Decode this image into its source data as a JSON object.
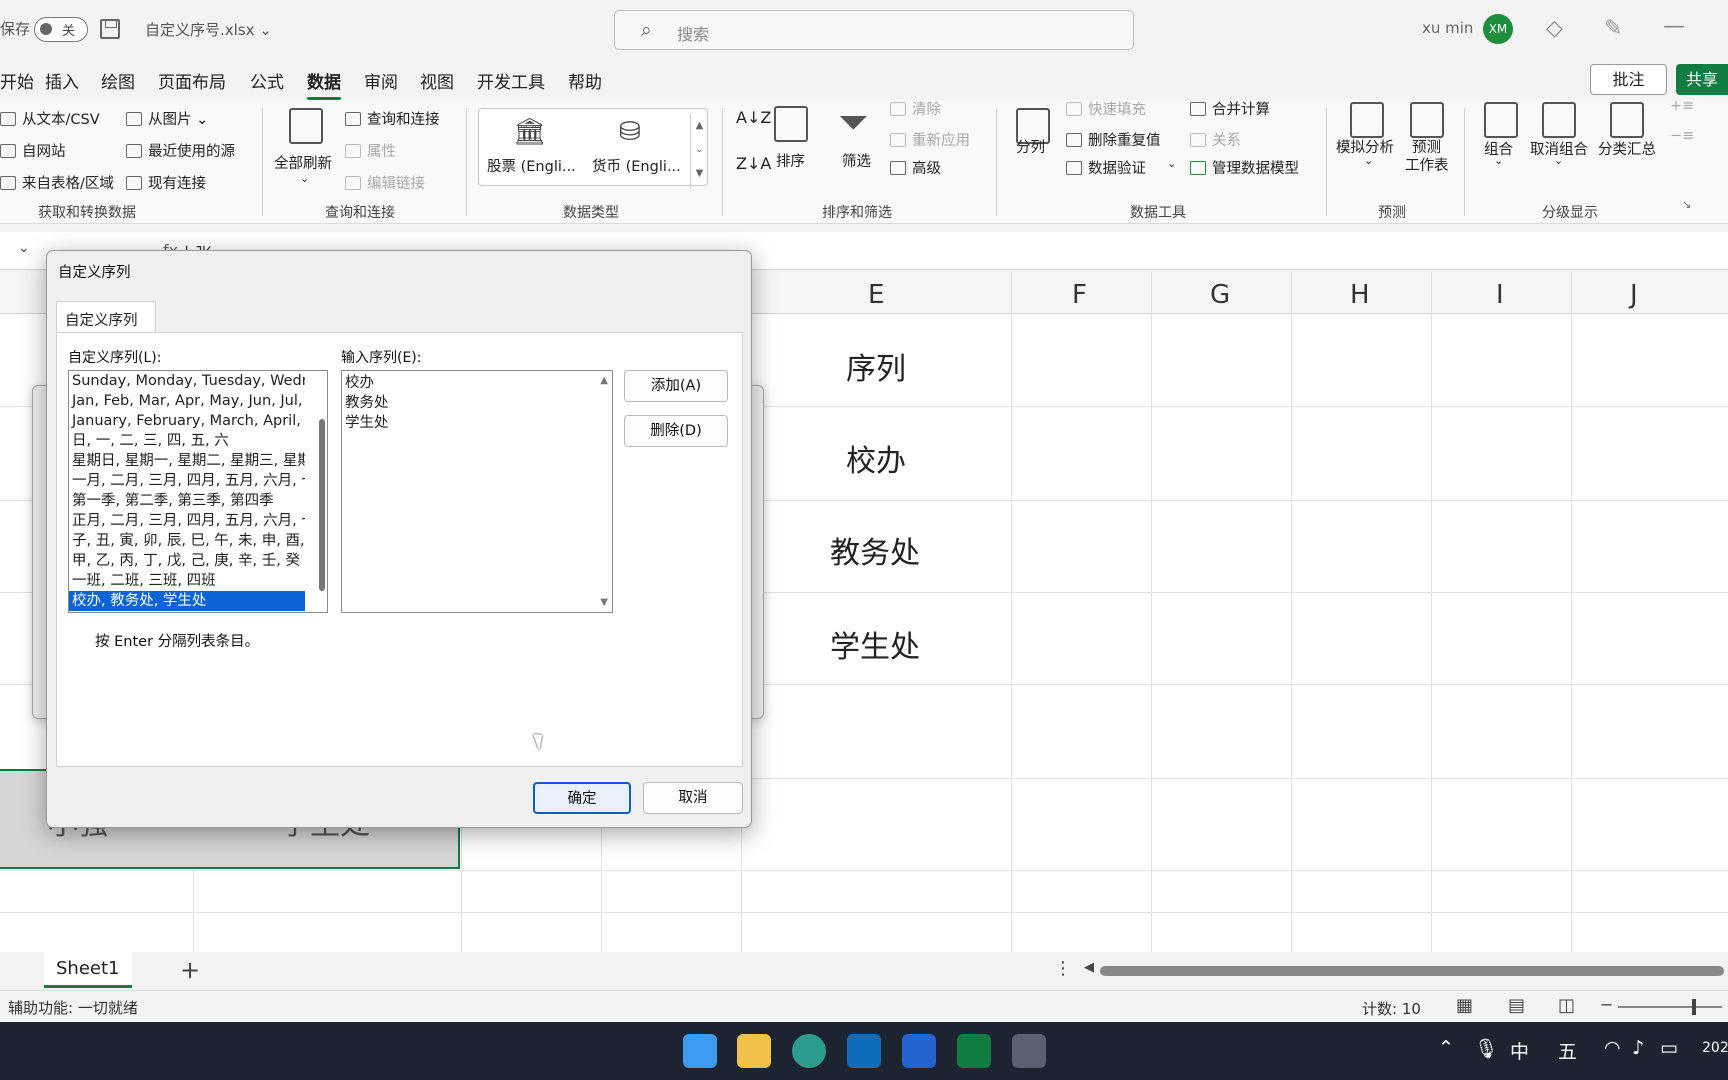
{
  "titlebar": {
    "autosave_label": "保存",
    "autosave_state": "关",
    "filename": "自定义序号.xlsx ⌄",
    "search_placeholder": "搜索",
    "user_name": "xu min",
    "avatar_initials": "XM",
    "brand_color": "#107c41"
  },
  "menu": {
    "tabs": [
      "开始",
      "插入",
      "绘图",
      "页面布局",
      "公式",
      "数据",
      "审阅",
      "视图",
      "开发工具",
      "帮助"
    ],
    "active_tab": "数据",
    "comment_button": "批注",
    "share_button": "共享"
  },
  "ribbon": {
    "get_transform": {
      "items": [
        "从文本/CSV",
        "自网站",
        "来自表格/区域",
        "从图片 ⌄",
        "最近使用的源",
        "现有连接"
      ],
      "group_label": "获取和转换数据"
    },
    "queries": {
      "refresh_all": "全部刷新",
      "items": [
        "查询和连接",
        "属性",
        "编辑链接"
      ],
      "group_label": "查询和连接"
    },
    "data_types": {
      "items": [
        "股票 (Engli...",
        "货币 (Engli..."
      ],
      "group_label": "数据类型"
    },
    "sort_filter": {
      "sort": "排序",
      "filter": "筛选",
      "items": [
        "清除",
        "重新应用",
        "高级"
      ],
      "group_label": "排序和筛选"
    },
    "data_tools": {
      "split": "分列",
      "items": [
        "快速填充",
        "删除重复值",
        "数据验证",
        "合并计算",
        "关系",
        "管理数据模型"
      ],
      "group_label": "数据工具"
    },
    "forecast": {
      "what_if": "模拟分析",
      "forecast_sheet_1": "预测",
      "forecast_sheet_2": "工作表",
      "group_label": "预测"
    },
    "outline": {
      "items": [
        "组合",
        "取消组合",
        "分类汇总"
      ],
      "group_label": "分级显示"
    }
  },
  "formula_bar": {
    "fx": "fx",
    "content": "小张"
  },
  "sheet": {
    "columns": [
      "E",
      "F",
      "G",
      "H",
      "I",
      "J"
    ],
    "cells_e": [
      "序列",
      "校办",
      "教务处",
      "学生处"
    ],
    "bottom_cells": [
      "小强",
      "学生处"
    ]
  },
  "dialog": {
    "title": "自定义序列",
    "tab": "自定义序列",
    "list_label": "自定义序列(L):",
    "input_label": "输入序列(E):",
    "lists": [
      "Sunday, Monday, Tuesday, Wednesday, Thursday, Friday, Saturday",
      "Jan, Feb, Mar, Apr, May, Jun, Jul, Aug, Sep, Oct, Nov, Dec",
      "January, February, March, April, May, June, July",
      "日, 一, 二, 三, 四, 五, 六",
      "星期日, 星期一, 星期二, 星期三, 星期四",
      "一月, 二月, 三月, 四月, 五月, 六月, 七月",
      "第一季, 第二季, 第三季, 第四季",
      "正月, 二月, 三月, 四月, 五月, 六月, 七月",
      "子, 丑, 寅, 卯, 辰, 巳, 午, 未, 申, 酉, 戌, 亥",
      "甲, 乙, 丙, 丁, 戊, 己, 庚, 辛, 壬, 癸",
      "一班, 二班, 三班, 四班",
      "校办, 教务处, 学生处"
    ],
    "selected_index": 11,
    "input_entries": [
      "校办",
      "教务处",
      "学生处"
    ],
    "add_button": "添加(A)",
    "delete_button": "删除(D)",
    "hint": "按 Enter 分隔列表条目。",
    "ok_button": "确定",
    "cancel_button": "取消"
  },
  "sheet_tabs": {
    "active_sheet": "Sheet1",
    "add_icon": "+"
  },
  "status": {
    "accessibility": "辅助功能: 一切就绪",
    "count": "计数: 10"
  },
  "taskbar": {
    "ime_1": "中",
    "ime_2": "五",
    "clock_partial": "202"
  }
}
